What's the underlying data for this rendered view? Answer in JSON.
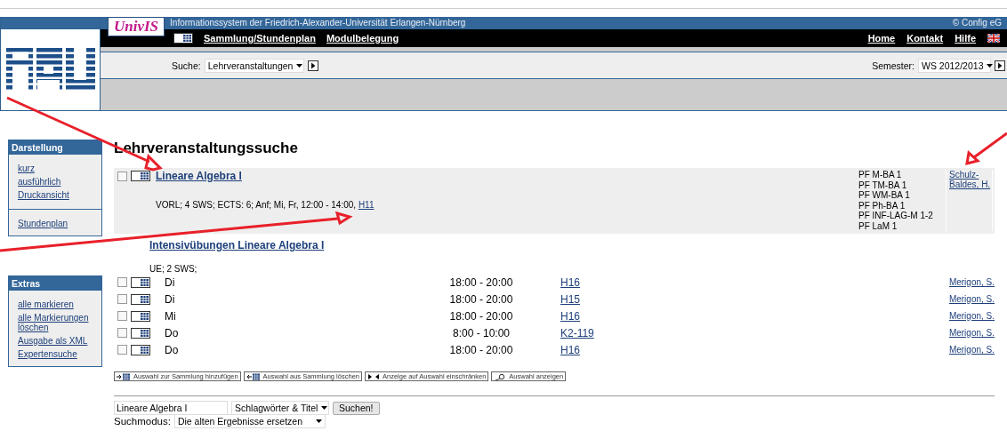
{
  "header": {
    "logo": "UnivIS",
    "tagline": "Informationssystem der Friedrich-Alexander-Universität Erlangen-Nürnberg",
    "copyright": "© Config eG"
  },
  "nav_left": [
    "Sammlung/Stundenplan",
    "Modulbelegung"
  ],
  "nav_right": [
    "Home",
    "Kontakt",
    "Hilfe"
  ],
  "search_bar": {
    "label": "Suche:",
    "value": "Lehrveranstaltungen"
  },
  "semester": {
    "label": "Semester:",
    "value": "WS 2012/2013"
  },
  "sidebar": [
    {
      "title": "Darstellung",
      "groups": [
        [
          "kurz",
          "ausführlich",
          "Druckansicht"
        ],
        [
          "Stundenplan"
        ]
      ]
    },
    {
      "title": "Extras",
      "groups": [
        [
          "alle markieren",
          "alle Markierungen löschen",
          "Ausgabe als XML",
          "Expertensuche"
        ]
      ]
    }
  ],
  "page_title": "Lehrveranstaltungssuche",
  "course": {
    "title": "Lineare Algebra I",
    "details": "VORL; 4 SWS; ECTS: 6; Anf; Mi, Fr, 12:00 - 14:00,",
    "room": "H11",
    "checked": false,
    "modules": [
      "PF M-BA 1",
      "PF TM-BA 1",
      "PF WM-BA 1",
      "PF Ph-BA 1",
      "PF INF-LAG-M 1-2",
      "PF LaM 1"
    ],
    "lecturer": "Schulz-Baldes, H."
  },
  "exercise": {
    "title": "Intensivübungen Lineare Algebra I",
    "details": "UE; 2 SWS;",
    "sessions": [
      {
        "day": "Di",
        "time": "18:00 - 20:00",
        "room": "H16",
        "lecturer": "Merigon, S.",
        "checked": false
      },
      {
        "day": "Di",
        "time": "18:00 - 20:00",
        "room": "H15",
        "lecturer": "Merigon, S.",
        "checked": false
      },
      {
        "day": "Mi",
        "time": "18:00 - 20:00",
        "room": "H16",
        "lecturer": "Merigon, S.",
        "checked": false
      },
      {
        "day": "Do",
        "time": "8:00 - 10:00",
        "room": "K2-119",
        "lecturer": "Merigon, S.",
        "checked": false
      },
      {
        "day": "Do",
        "time": "18:00 - 20:00",
        "room": "H16",
        "lecturer": "Merigon, S.",
        "checked": false
      }
    ]
  },
  "actions": [
    {
      "label": "Auswahl zur Sammlung hinzufügen",
      "kind": "add"
    },
    {
      "label": "Auswahl aus Sammlung löschen",
      "kind": "remove"
    },
    {
      "label": "Anzeige auf Auswahl einschränken",
      "kind": "restrict"
    },
    {
      "label": "Auswahl anzeigen",
      "kind": "show"
    }
  ],
  "query": {
    "value": "Lineare Algebra I",
    "field": "Schlagwörter & Titel",
    "button": "Suchen!",
    "mode_label": "Suchmodus:",
    "mode": "Die alten Ergebnisse ersetzen"
  }
}
